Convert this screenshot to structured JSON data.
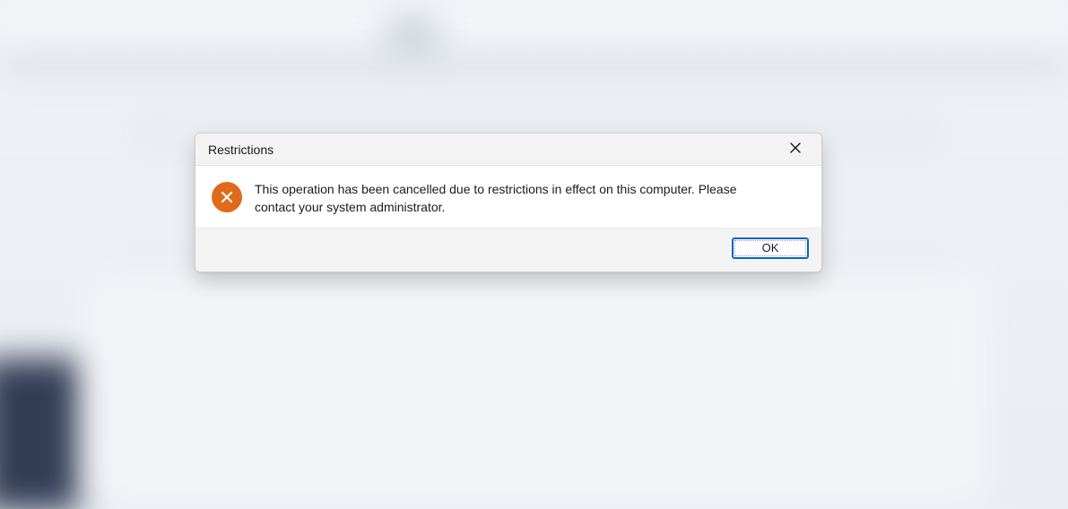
{
  "dialog": {
    "title": "Restrictions",
    "message": "This operation has been cancelled due to restrictions in effect on this computer. Please contact your system administrator.",
    "ok_label": "OK",
    "icon_name": "error-x",
    "icon_color": "#e06a1b"
  }
}
